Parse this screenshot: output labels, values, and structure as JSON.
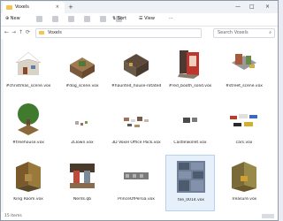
{
  "window": {
    "tab_title": "Voxels",
    "new_tab": "+",
    "minimize": "—",
    "maximize": "□",
    "close": "×"
  },
  "toolbar": {
    "new_label": "New",
    "sort_label": "Sort",
    "view_label": "View",
    "more": "···"
  },
  "address": {
    "back": "←",
    "forward": "→",
    "up": "↑",
    "refresh": "⟳",
    "breadcrumb": "Voxels"
  },
  "search": {
    "placeholder": "Search Voxels"
  },
  "items": [
    {
      "name": "#christmas_scene.vox",
      "icon": "house-scene-icon"
    },
    {
      "name": "#dog_scene.vox",
      "icon": "dog-scene-icon"
    },
    {
      "name": "#haunted_house-rotated.vox",
      "icon": "haunted-house-icon"
    },
    {
      "name": "#red_booth_solid.vox",
      "icon": "red-booth-icon"
    },
    {
      "name": "#street_scene.vox",
      "icon": "street-scene-icon"
    },
    {
      "name": "#treehouse.vox",
      "icon": "treehouse-icon"
    },
    {
      "name": "2LTown.vox",
      "icon": "small-town-icon"
    },
    {
      "name": "3D Voxel Office Pack.vox",
      "icon": "office-pack-icon"
    },
    {
      "name": "CastleSkillet.vox",
      "icon": "castle-icon"
    },
    {
      "name": "cars.vox",
      "icon": "cars-icon"
    },
    {
      "name": "King Room.vox",
      "icon": "king-room-icon"
    },
    {
      "name": "Nerds.qb",
      "icon": "nerds-icon"
    },
    {
      "name": "PrinceOfPersia.vox",
      "icon": "prince-icon"
    },
    {
      "name": "tile_0014.vox",
      "icon": "tile-icon"
    },
    {
      "name": "Treasure.vox",
      "icon": "treasure-icon"
    }
  ],
  "status": {
    "count": "15 items"
  },
  "colors": {
    "accent": "#0067c0",
    "folder": "#f6c44e",
    "selection": "#e6f0fb"
  }
}
